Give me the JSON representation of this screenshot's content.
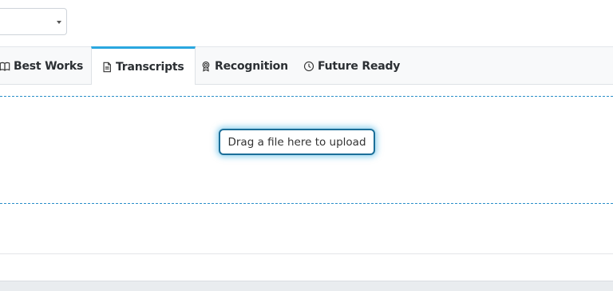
{
  "select": {
    "value": ""
  },
  "tabs": [
    {
      "label": "Best Works",
      "icon": "book-icon"
    },
    {
      "label": "Transcripts",
      "icon": "document-icon",
      "active": true
    },
    {
      "label": "Recognition",
      "icon": "award-icon"
    },
    {
      "label": "Future Ready",
      "icon": "clock-icon"
    }
  ],
  "upload": {
    "label": "Drag a file here to upload"
  },
  "colors": {
    "accent": "#2aa7df",
    "dashed_border": "#2b8fc9",
    "tab_bar_bg": "#f8f9fa"
  }
}
